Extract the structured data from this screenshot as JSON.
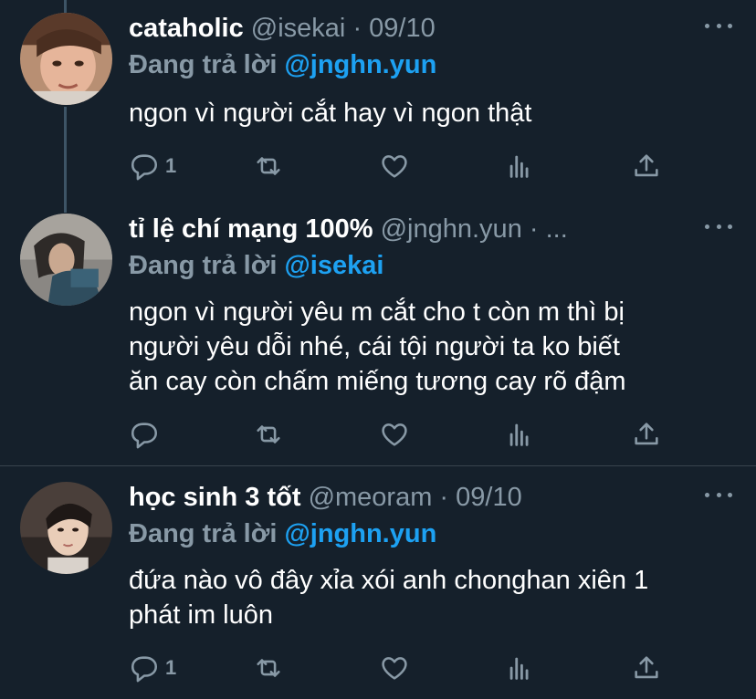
{
  "tweets": [
    {
      "name": "cataholic",
      "handle": "@isekai",
      "sep": "·",
      "date": "09/10",
      "reply_prefix": "Đang trả lời",
      "reply_mention": "@jnghn.yun",
      "lines": [
        "ngon vì người cắt hay vì ngon thật"
      ],
      "reply_count": "1"
    },
    {
      "name": "tỉ lệ chí mạng 100%",
      "handle": "@jnghn.yun",
      "sep": "·",
      "date": "...",
      "reply_prefix": "Đang trả lời",
      "reply_mention": "@isekai",
      "lines": [
        "ngon vì người yêu m cắt cho t còn m thì bị",
        "người yêu dỗi nhé, cái tội người ta ko biết",
        "ăn cay còn chấm miếng tương cay rõ đậm"
      ],
      "reply_count": ""
    },
    {
      "name": "học sinh 3 tốt",
      "handle": "@meoram",
      "sep": "·",
      "date": "09/10",
      "reply_prefix": "Đang trả lời",
      "reply_mention": "@jnghn.yun",
      "lines": [
        "đứa nào vô đây xỉa xói anh chonghan xiên 1",
        "phát im luôn"
      ],
      "reply_count": "1"
    }
  ],
  "colors": {
    "background": "#15202b",
    "muted": "#8899a6",
    "mention": "#1da1f2",
    "divider": "#38444d",
    "thread_line": "#3d5466"
  },
  "icons": [
    "reply-icon",
    "retweet-icon",
    "like-icon",
    "analytics-icon",
    "share-icon",
    "more-icon"
  ]
}
